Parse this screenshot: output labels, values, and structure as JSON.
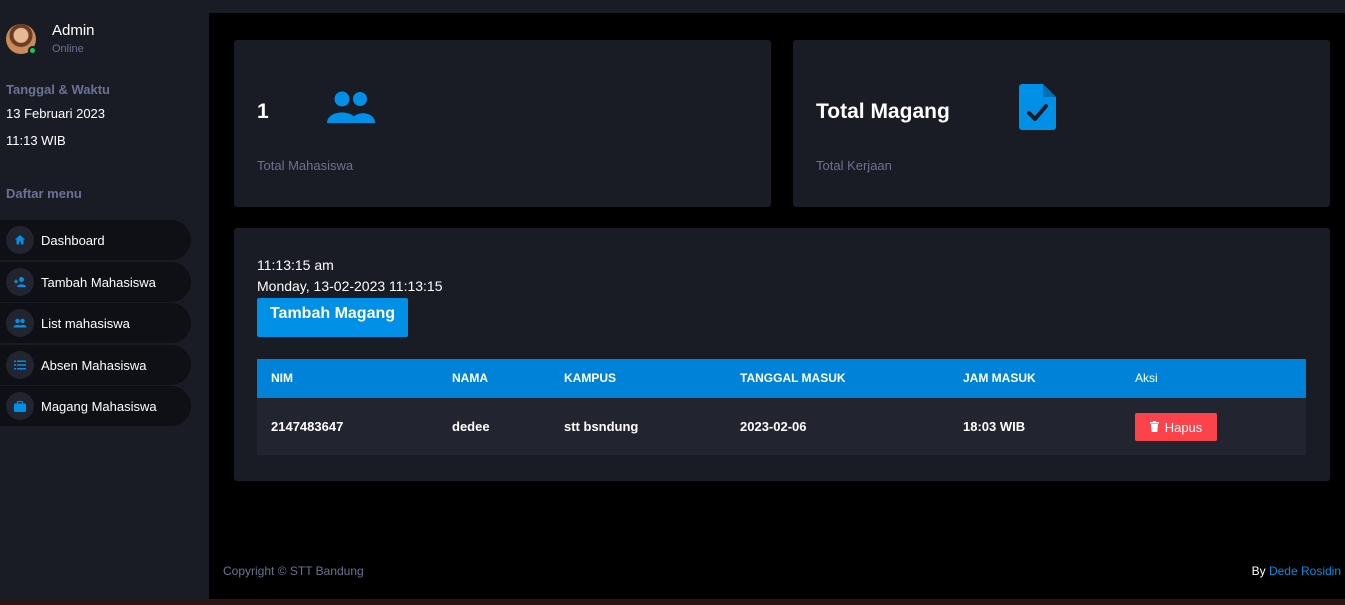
{
  "profile": {
    "name": "Admin",
    "status": "Online"
  },
  "sidebar": {
    "datetime_heading": "Tanggal & Waktu",
    "date": "13 Februari 2023",
    "time": "11:13 WIB",
    "menu_heading": "Daftar menu",
    "items": [
      {
        "label": "Dashboard",
        "icon": "home-icon"
      },
      {
        "label": "Tambah Mahasiswa",
        "icon": "user-plus-icon"
      },
      {
        "label": "List mahasiswa",
        "icon": "users-icon"
      },
      {
        "label": "Absen Mahasiswa",
        "icon": "list-icon"
      },
      {
        "label": "Magang Mahasiswa",
        "icon": "briefcase-icon"
      }
    ]
  },
  "stats": [
    {
      "value": "1",
      "label": "Total Mahasiswa",
      "icon": "users-icon"
    },
    {
      "value": "Total Magang",
      "label": "Total Kerjaan",
      "icon": "file-check-icon"
    }
  ],
  "main": {
    "clock": "11:13:15 am",
    "date_line": "Monday, 13-02-2023 11:13:15",
    "add_button": "Tambah Magang"
  },
  "table": {
    "headers": [
      "NIM",
      "NAMA",
      "KAMPUS",
      "TANGGAL MASUK",
      "JAM MASUK",
      "Aksi"
    ],
    "rows": [
      {
        "nim": "2147483647",
        "nama": "dedee",
        "kampus": "stt bsndung",
        "tanggal_masuk": "2023-02-06",
        "jam_masuk": "18:03 WIB",
        "action": "Hapus"
      }
    ]
  },
  "footer": {
    "copyright": "Copyright © STT Bandung",
    "by_prefix": "By",
    "author": "Dede Rosidin"
  },
  "colors": {
    "background": "#000000",
    "panel": "#191c24",
    "accent": "#0090e7",
    "danger": "#fc424a",
    "online": "#00d25b",
    "muted": "#6c7293"
  }
}
